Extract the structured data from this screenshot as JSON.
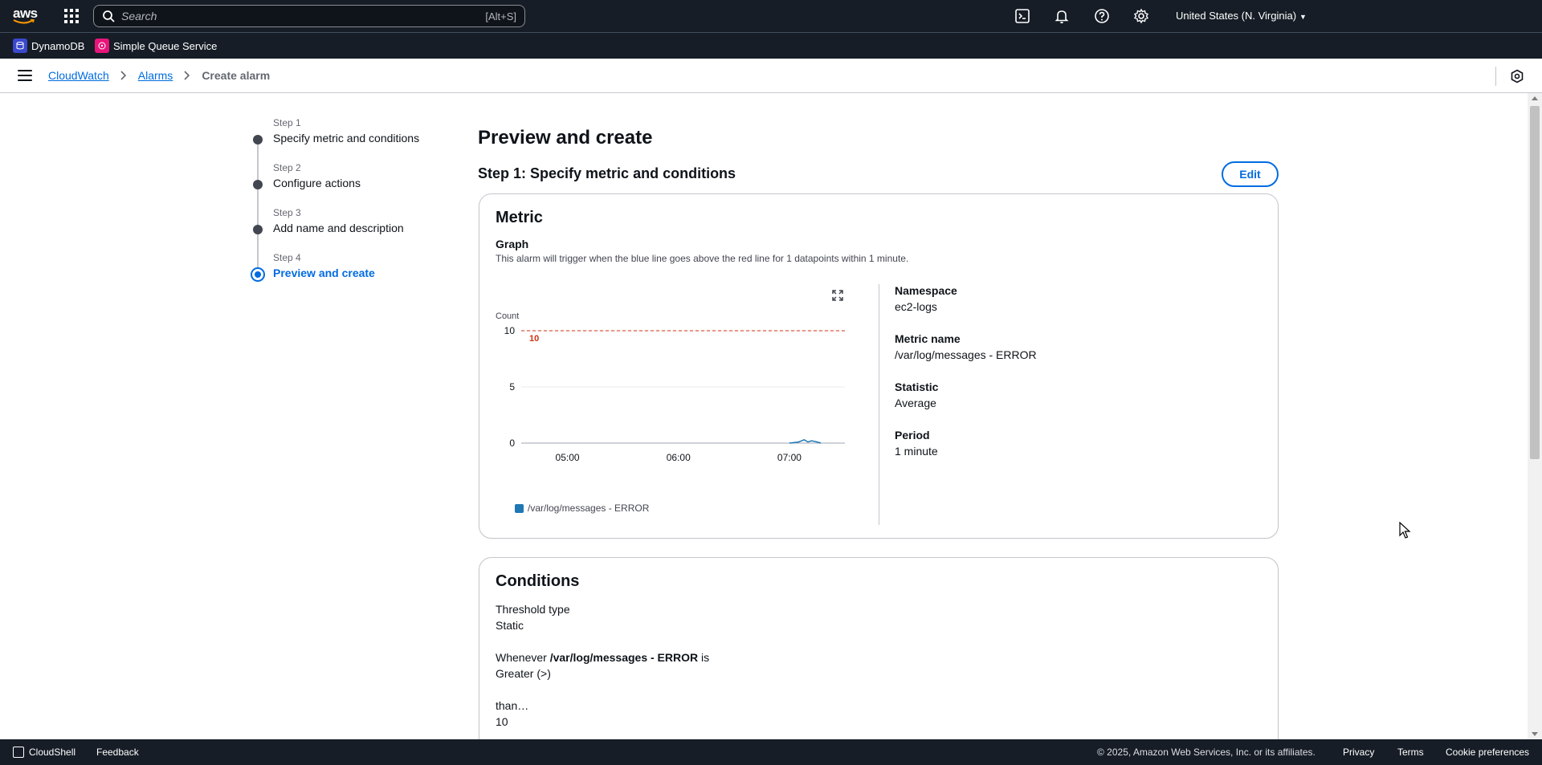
{
  "topnav": {
    "logo_text": "aws",
    "search_placeholder": "Search",
    "search_shortcut": "[Alt+S]",
    "region": "United States (N. Virginia)",
    "icons": [
      "cloudshell-icon",
      "bell-icon",
      "help-icon",
      "gear-icon"
    ]
  },
  "favorites": [
    {
      "label": "DynamoDB",
      "icon": "dynamodb-icon",
      "color": "#3b48cc"
    },
    {
      "label": "Simple Queue Service",
      "icon": "sqs-icon",
      "color": "#e7157b"
    }
  ],
  "breadcrumb": {
    "items": [
      "CloudWatch",
      "Alarms"
    ],
    "current": "Create alarm"
  },
  "steps": [
    {
      "num": "Step 1",
      "label": "Specify metric and conditions"
    },
    {
      "num": "Step 2",
      "label": "Configure actions"
    },
    {
      "num": "Step 3",
      "label": "Add name and description"
    },
    {
      "num": "Step 4",
      "label": "Preview and create",
      "active": true
    }
  ],
  "page": {
    "title": "Preview and create",
    "section_title": "Step 1: Specify metric and conditions",
    "edit_label": "Edit"
  },
  "metric_card": {
    "title": "Metric",
    "graph_label": "Graph",
    "graph_desc": "This alarm will trigger when the blue line goes above the red line for 1 datapoints within 1 minute.",
    "namespace_label": "Namespace",
    "namespace_value": "ec2-logs",
    "metric_name_label": "Metric name",
    "metric_name_value": "/var/log/messages - ERROR",
    "statistic_label": "Statistic",
    "statistic_value": "Average",
    "period_label": "Period",
    "period_value": "1 minute"
  },
  "chart_data": {
    "type": "line",
    "ylabel": "Count",
    "ylim": [
      0,
      10
    ],
    "yticks": [
      "10",
      "5",
      "0"
    ],
    "xticks": [
      "05:00",
      "06:00",
      "07:00"
    ],
    "threshold": 10,
    "threshold_label": "10",
    "threshold_color": "#d13212",
    "series": [
      {
        "name": "/var/log/messages - ERROR",
        "color": "#1f77b4",
        "x": [
          "07:00",
          "07:05",
          "07:08",
          "07:10",
          "07:12",
          "07:15",
          "07:17"
        ],
        "values": [
          0,
          0.1,
          0.3,
          0.1,
          0.2,
          0.1,
          0
        ]
      }
    ],
    "legend": [
      "/var/log/messages - ERROR"
    ]
  },
  "conditions_card": {
    "title": "Conditions",
    "threshold_type_label": "Threshold type",
    "threshold_type_value": "Static",
    "whenever_prefix": "Whenever",
    "whenever_metric": "/var/log/messages - ERROR",
    "whenever_suffix": "is",
    "comparison": "Greater (>)",
    "than_label": "than…",
    "than_value": "10"
  },
  "footer": {
    "cloudshell": "CloudShell",
    "feedback": "Feedback",
    "copyright": "© 2025, Amazon Web Services, Inc. or its affiliates.",
    "privacy": "Privacy",
    "terms": "Terms",
    "cookies": "Cookie preferences"
  }
}
